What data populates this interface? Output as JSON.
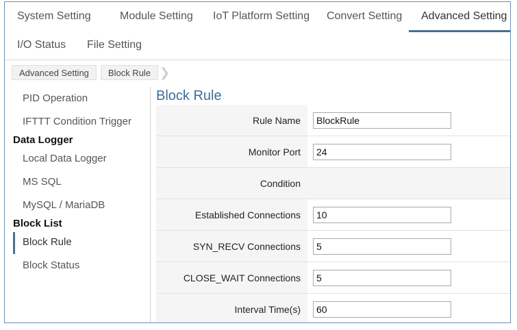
{
  "nav": {
    "row1": [
      {
        "label": "System Setting"
      },
      {
        "label": "Module Setting"
      },
      {
        "label": "IoT Platform Setting"
      },
      {
        "label": "Convert Setting"
      },
      {
        "label": "Advanced Setting",
        "active": true
      }
    ],
    "row2": [
      {
        "label": "I/O Status"
      },
      {
        "label": "File Setting"
      }
    ]
  },
  "breadcrumb": [
    "Advanced Setting",
    "Block Rule"
  ],
  "sidebar": {
    "items": [
      {
        "type": "item",
        "label": "PID Operation"
      },
      {
        "type": "item",
        "label": "IFTTT Condition Trigger"
      },
      {
        "type": "group",
        "label": "Data Logger"
      },
      {
        "type": "item",
        "label": "Local Data Logger"
      },
      {
        "type": "item",
        "label": "MS SQL"
      },
      {
        "type": "item",
        "label": "MySQL / MariaDB"
      },
      {
        "type": "group",
        "label": "Block List"
      },
      {
        "type": "item",
        "label": "Block Rule",
        "active": true
      },
      {
        "type": "item",
        "label": "Block Status"
      }
    ]
  },
  "main": {
    "title": "Block Rule",
    "rows": [
      {
        "label": "Rule Name",
        "value": "BlockRule"
      },
      {
        "label": "Monitor Port",
        "value": "24"
      },
      {
        "label": "Condition"
      },
      {
        "label": "Established Connections",
        "value": "10"
      },
      {
        "label": "SYN_RECV Connections",
        "value": "5"
      },
      {
        "label": "CLOSE_WAIT Connections",
        "value": "5"
      },
      {
        "label": "Interval Time(s)",
        "value": "60"
      }
    ]
  },
  "colors": {
    "accent": "#4a6d92",
    "title": "#3c6c9c",
    "label_bg": "#f5f5f5"
  }
}
